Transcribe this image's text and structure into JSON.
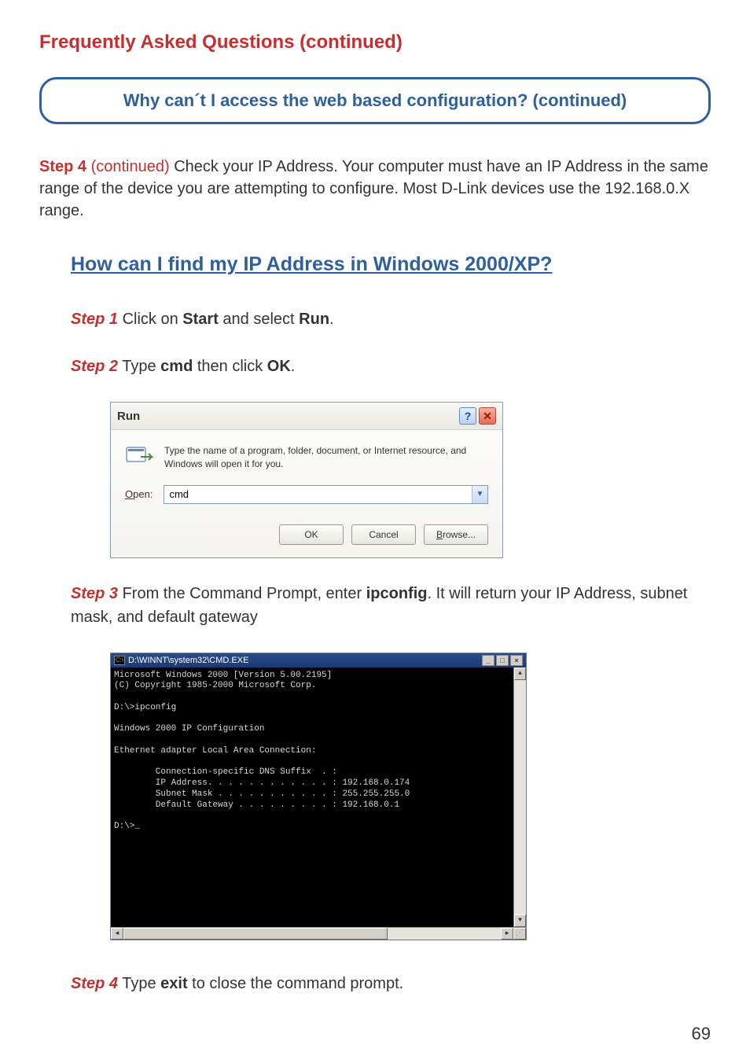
{
  "pageTitle": "Frequently Asked Questions (continued)",
  "questionBanner": "Why can´t I access the web based configuration? (continued)",
  "introPara": {
    "stepLabel": "Step 4",
    "continued": " (continued) ",
    "body": "Check your IP Address. Your computer must have an IP Address in the same range of the device you are attempting to configure. Most D-Link devices use the 192.168.0.X range."
  },
  "sectionHeading": "How can I find my IP Address in Windows 2000/XP?",
  "step1": {
    "label": "Step 1",
    "pre": " Click on ",
    "b1": "Start",
    "mid": " and select ",
    "b2": "Run",
    "end": "."
  },
  "step2": {
    "label": "Step 2",
    "pre": " Type ",
    "b1": "cmd",
    "mid": " then click ",
    "b2": "OK",
    "end": "."
  },
  "runDialog": {
    "title": "Run",
    "helpGlyph": "?",
    "closeGlyph": "✕",
    "description": "Type the name of a program, folder, document, or Internet resource, and Windows will open it for you.",
    "openLabelU": "O",
    "openLabelRest": "pen:",
    "openValue": "cmd",
    "ok": "OK",
    "cancel": "Cancel",
    "browseU": "B",
    "browseRest": "rowse..."
  },
  "step3": {
    "label": "Step 3",
    "pre": " From the Command Prompt, enter ",
    "b1": "ipconfig",
    "end": ". It will return your IP Address, subnet mask, and default gateway"
  },
  "cmd": {
    "iconText": "C:\\",
    "title": "D:\\WINNT\\system32\\CMD.EXE",
    "min": "_",
    "max": "□",
    "close": "×",
    "body": "Microsoft Windows 2000 [Version 5.00.2195]\n(C) Copyright 1985-2000 Microsoft Corp.\n\nD:\\>ipconfig\n\nWindows 2000 IP Configuration\n\nEthernet adapter Local Area Connection:\n\n        Connection-specific DNS Suffix  . :\n        IP Address. . . . . . . . . . . . : 192.168.0.174\n        Subnet Mask . . . . . . . . . . . : 255.255.255.0\n        Default Gateway . . . . . . . . . : 192.168.0.1\n\nD:\\>_"
  },
  "step4": {
    "label": "Step 4",
    "pre": " Type ",
    "b1": "exit",
    "end": " to close the command prompt."
  },
  "pageNumber": "69"
}
